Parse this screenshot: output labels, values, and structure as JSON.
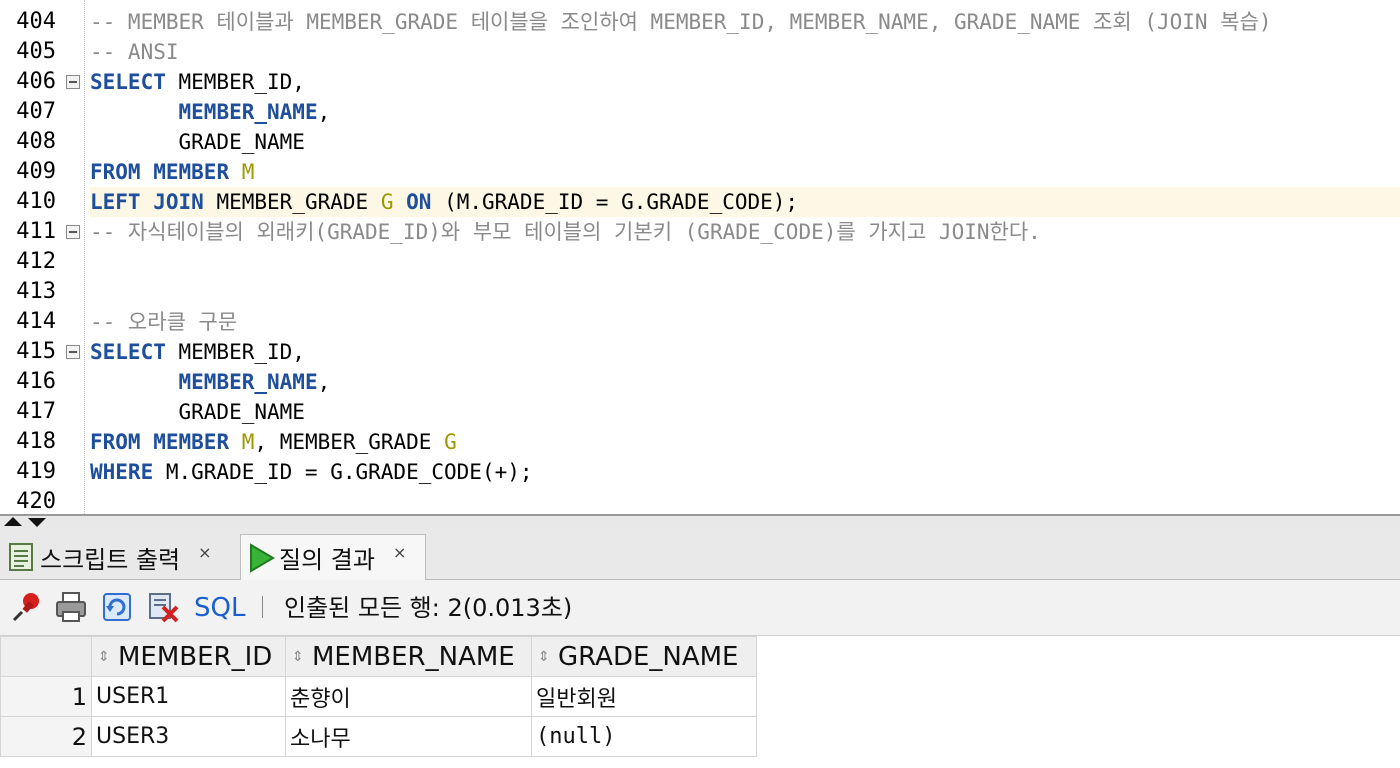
{
  "editor": {
    "first_line": 404,
    "highlight_line": 410,
    "fold_lines": [
      406,
      411,
      415
    ],
    "lines": [
      [
        {
          "t": "-- MEMBER 테이블과 MEMBER_GRADE 테이블을 조인하여 MEMBER_ID, MEMBER_NAME, GRADE_NAME 조회 (JOIN 복습)",
          "c": "cm"
        }
      ],
      [
        {
          "t": "-- ANSI",
          "c": "cm"
        }
      ],
      [
        {
          "t": "SELECT",
          "c": "kw"
        },
        {
          "t": " MEMBER_ID,",
          "c": "tx"
        }
      ],
      [
        {
          "t": "       ",
          "c": "tx"
        },
        {
          "t": "MEMBER_NAME",
          "c": "kw"
        },
        {
          "t": ",",
          "c": "tx"
        }
      ],
      [
        {
          "t": "       GRADE_NAME",
          "c": "tx"
        }
      ],
      [
        {
          "t": "FROM",
          "c": "kw"
        },
        {
          "t": " ",
          "c": "tx"
        },
        {
          "t": "MEMBER",
          "c": "kw"
        },
        {
          "t": " ",
          "c": "tx"
        },
        {
          "t": "M",
          "c": "al"
        }
      ],
      [
        {
          "t": "LEFT JOIN",
          "c": "kw"
        },
        {
          "t": " MEMBER_GRADE ",
          "c": "tx"
        },
        {
          "t": "G",
          "c": "al"
        },
        {
          "t": " ",
          "c": "tx"
        },
        {
          "t": "ON",
          "c": "kw"
        },
        {
          "t": " (M.GRADE_ID = G.GRADE_CODE);",
          "c": "tx"
        }
      ],
      [
        {
          "t": "-- 자식테이블의 외래키(GRADE_ID)와 부모 테이블의 기본키 (GRADE_CODE)를 가지고 JOIN한다.",
          "c": "cm"
        }
      ],
      [],
      [],
      [
        {
          "t": "-- 오라클 구문",
          "c": "cm"
        }
      ],
      [
        {
          "t": "SELECT",
          "c": "kw"
        },
        {
          "t": " MEMBER_ID,",
          "c": "tx"
        }
      ],
      [
        {
          "t": "       ",
          "c": "tx"
        },
        {
          "t": "MEMBER_NAME",
          "c": "kw"
        },
        {
          "t": ",",
          "c": "tx"
        }
      ],
      [
        {
          "t": "       GRADE_NAME",
          "c": "tx"
        }
      ],
      [
        {
          "t": "FROM",
          "c": "kw"
        },
        {
          "t": " ",
          "c": "tx"
        },
        {
          "t": "MEMBER",
          "c": "kw"
        },
        {
          "t": " ",
          "c": "tx"
        },
        {
          "t": "M",
          "c": "al"
        },
        {
          "t": ", MEMBER_GRADE ",
          "c": "tx"
        },
        {
          "t": "G",
          "c": "al"
        }
      ],
      [
        {
          "t": "WHERE",
          "c": "kw"
        },
        {
          "t": " M.GRADE_ID = G.GRADE_CODE(+);",
          "c": "tx"
        }
      ],
      []
    ]
  },
  "tabs": {
    "script_output": "스크립트 출력",
    "query_result": "질의 결과",
    "close": "×"
  },
  "toolbar": {
    "sql": "SQL",
    "status": "인출된 모든 행: 2(0.013초)"
  },
  "grid": {
    "columns": [
      "MEMBER_ID",
      "MEMBER_NAME",
      "GRADE_NAME"
    ],
    "rows": [
      {
        "n": "1",
        "cells": [
          "USER1",
          "춘향이",
          "일반회원"
        ]
      },
      {
        "n": "2",
        "cells": [
          "USER3",
          "소나무",
          "(null)"
        ]
      }
    ]
  }
}
